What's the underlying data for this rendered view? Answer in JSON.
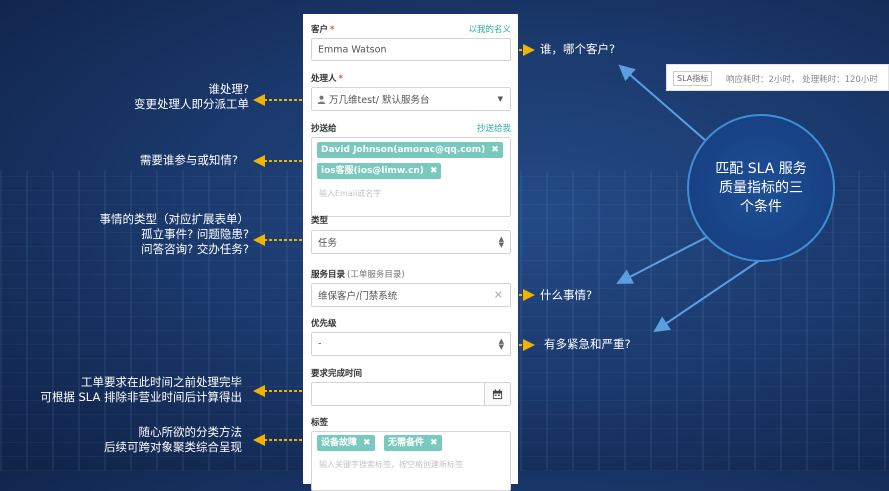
{
  "form": {
    "customer": {
      "label": "客户",
      "required": "*",
      "link": "以我的名义",
      "value": "Emma Watson"
    },
    "handler": {
      "label": "处理人",
      "required": "*",
      "value": "万几维test/ 默认服务台"
    },
    "cc": {
      "label": "抄送给",
      "link": "抄送给我",
      "tags": [
        "David Johnson(amorac@qq.com)",
        "ios客服(ios@limw.cn)"
      ],
      "placeholder": "输入Email或名字",
      "remove_glyph": "✖"
    },
    "type": {
      "label": "类型",
      "value": "任务"
    },
    "catalog": {
      "label": "服务目录",
      "sub": "(工单服务目录)",
      "value": "维保客户/门禁系统"
    },
    "priority": {
      "label": "优先级",
      "value": "-"
    },
    "due": {
      "label": "要求完成时间",
      "value": ""
    },
    "tags": {
      "label": "标签",
      "items": [
        "设备故障",
        "无需备件"
      ],
      "placeholder": "输入关键字搜索标签，按空格创建新标签"
    }
  },
  "annotations": {
    "who_customer": "谁，哪个客户?",
    "who_handles_1": "谁处理?",
    "who_handles_2": "变更处理人即分派工单",
    "who_involved": "需要谁参与或知情?",
    "type_1": "事情的类型（对应扩展表单）",
    "type_2": "孤立事件? 问题隐患?",
    "type_3": "问答咨询? 交办任务?",
    "what": "什么事情?",
    "urgency": "有多紧急和严重?",
    "due_1": "工单要求在此时间之前处理完毕",
    "due_2": "可根据 SLA 排除非营业时间后计算得出",
    "tags_1": "随心所欲的分类方法",
    "tags_2": "后续可跨对象聚类综合呈现",
    "sla_circle": "匹配 SLA 服务质量指标的三个条件"
  },
  "sla_bar": {
    "tag": "SLA指标",
    "text": "响应耗时：2小时， 处理耗时：120小时"
  },
  "colors": {
    "accent_arrow": "#f0b400",
    "teal": "#79c9be",
    "circle_border": "#3f8fd6",
    "link": "#2bb0a0"
  },
  "icons": {
    "user": "user-icon",
    "calendar": "calendar-icon",
    "caret": "caret-down-icon",
    "clear": "clear-icon"
  }
}
